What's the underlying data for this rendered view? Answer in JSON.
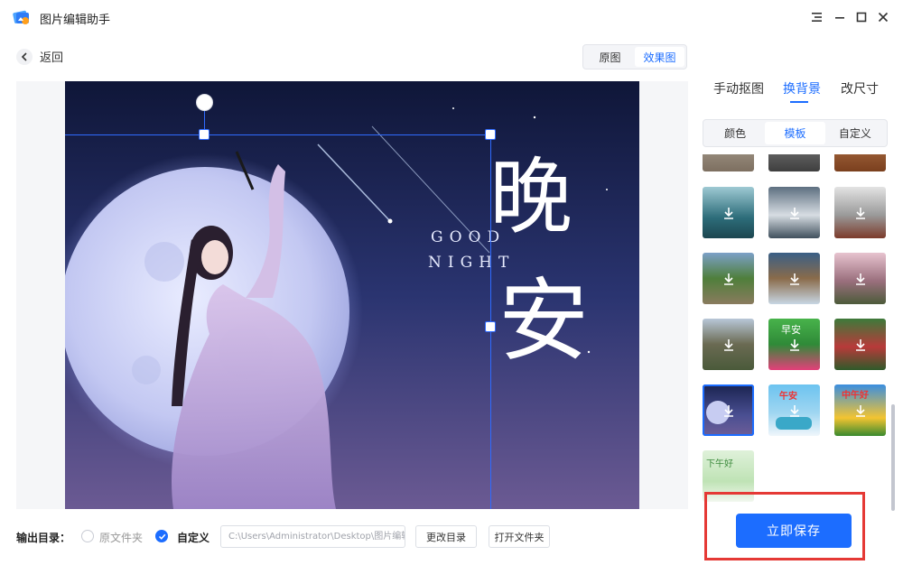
{
  "app": {
    "title": "图片编辑助手"
  },
  "window_controls": [
    "menu-icon",
    "minimize-icon",
    "maximize-icon",
    "close-icon"
  ],
  "toolbar": {
    "back_label": "返回",
    "view_options": [
      "原图",
      "效果图"
    ],
    "view_selected": "效果图"
  },
  "canvas": {
    "poster_text_cn_1": "晚",
    "poster_text_cn_2": "安",
    "poster_text_en_1": "GOOD",
    "poster_text_en_2": "NIGHT"
  },
  "panel": {
    "tabs": [
      "手动抠图",
      "换背景",
      "改尺寸"
    ],
    "tab_selected": "换背景",
    "subtabs": [
      "颜色",
      "模板",
      "自定义"
    ],
    "subtab_selected": "模板",
    "template_texts": {
      "t1": "早安",
      "t2": "午安",
      "t3": "中午好",
      "t4": "下午好"
    }
  },
  "output": {
    "label": "输出目录：",
    "option_original": "原文件夹",
    "option_custom": "自定义",
    "selected": "自定义",
    "path_value": "C:\\Users\\Administrator\\Desktop\\图片编辑",
    "change_dir_label": "更改目录",
    "open_folder_label": "打开文件夹"
  },
  "actions": {
    "save_label": "立即保存"
  },
  "colors": {
    "accent": "#1c6dff",
    "highlight_frame": "#e53935"
  }
}
